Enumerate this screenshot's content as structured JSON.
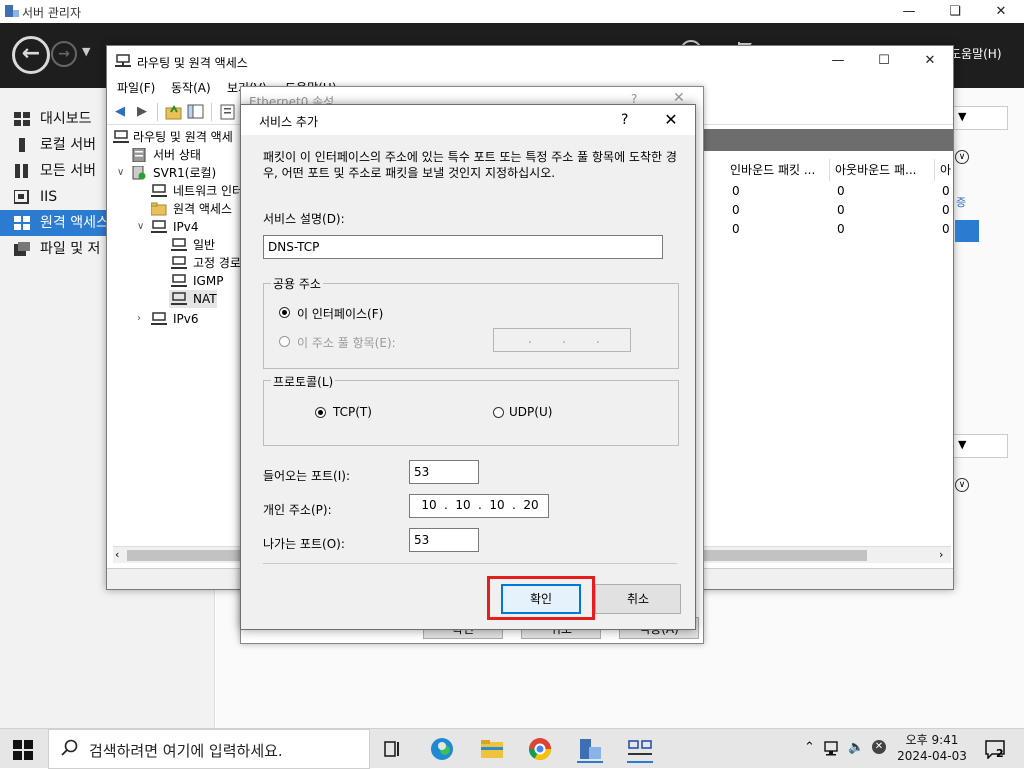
{
  "server_manager": {
    "title": "서버 관리자",
    "header_help": "도움말(H)",
    "nav": [
      {
        "label": "대시보드",
        "icon": "dashboard-icon"
      },
      {
        "label": "로컬 서버",
        "icon": "local-server-icon"
      },
      {
        "label": "모든 서버",
        "icon": "all-servers-icon"
      },
      {
        "label": "IIS",
        "icon": "iis-icon"
      },
      {
        "label": "원격 액세스",
        "icon": "remote-access-icon",
        "selected": true
      },
      {
        "label": "파일 및 저",
        "icon": "file-storage-icon"
      }
    ]
  },
  "rras": {
    "title": "라우팅 및 원격 액세스",
    "menu": [
      "파일(F)",
      "동작(A)",
      "보기(V)",
      "도움말(H)"
    ],
    "tree": [
      {
        "label": "라우팅 및 원격 액세",
        "level": 0
      },
      {
        "label": "서버 상태",
        "level": 1
      },
      {
        "label": "SVR1(로컬)",
        "level": 1,
        "expanded": true
      },
      {
        "label": "네트워크 인터",
        "level": 2
      },
      {
        "label": "원격 액세스",
        "level": 2
      },
      {
        "label": "IPv4",
        "level": 2,
        "expanded": true
      },
      {
        "label": "일반",
        "level": 3
      },
      {
        "label": "고정 경로",
        "level": 3
      },
      {
        "label": "IGMP",
        "level": 3
      },
      {
        "label": "NAT",
        "level": 3,
        "selected": true
      },
      {
        "label": "IPv6",
        "level": 2,
        "collapsed": true
      }
    ],
    "columns": [
      "인바운드 패킷 ...",
      "아웃바운드 패...",
      "아"
    ],
    "rows": [
      [
        "0",
        "0",
        "0"
      ],
      [
        "0",
        "0",
        "0"
      ],
      [
        "0",
        "0",
        "0"
      ]
    ]
  },
  "eth_dialog": {
    "title": "Ethernet0 속성",
    "help": "?",
    "ok": "확인",
    "cancel": "취소",
    "apply": "적용(A)"
  },
  "add_service": {
    "title": "서비스 추가",
    "help": "?",
    "description": "패킷이 이 인터페이스의 주소에 있는 특수 포트 또는 특정 주소 풀 항목에 도착한 경우, 어떤 포트 및 주소로 패킷을 보낼 것인지 지정하십시오.",
    "desc_label": "서비스 설명(D):",
    "desc_value": "DNS-TCP",
    "public_group": "공용 주소",
    "this_interface": "이 인터페이스(F)",
    "address_pool": "이 주소 풀 항목(E):",
    "protocol_group": "프로토콜(L)",
    "tcp": "TCP(T)",
    "udp": "UDP(U)",
    "incoming_port_label": "들어오는 포트(I):",
    "incoming_port": "53",
    "private_addr_label": "개인 주소(P):",
    "private_addr": [
      "10",
      "10",
      "10",
      "20"
    ],
    "outgoing_port_label": "나가는 포트(O):",
    "outgoing_port": "53",
    "ok": "확인",
    "cancel": "취소"
  },
  "taskbar": {
    "search_placeholder": "검색하려면 여기에 입력하세요.",
    "time": "오후 9:41",
    "date": "2024-04-03",
    "notifications": "2"
  }
}
